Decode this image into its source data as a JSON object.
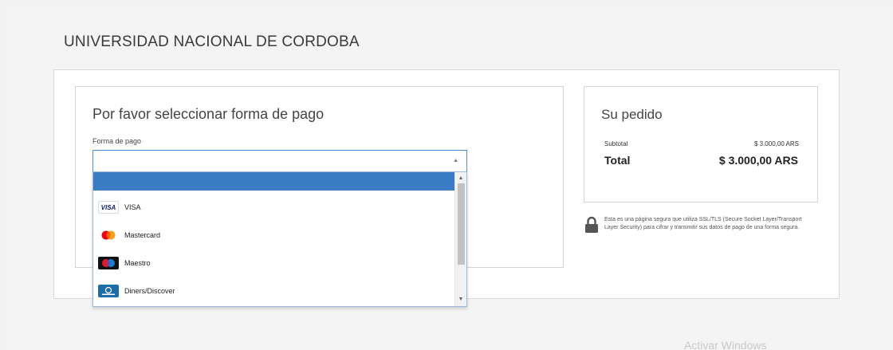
{
  "header": {
    "title": "UNIVERSIDAD NACIONAL DE CORDOBA"
  },
  "payment": {
    "heading": "Por favor seleccionar forma de pago",
    "field_label": "Forma de pago",
    "selected_value": "",
    "options": [
      {
        "label": "VISA",
        "icon": "visa-icon",
        "icon_text": "VISA"
      },
      {
        "label": "Mastercard",
        "icon": "mastercard-icon"
      },
      {
        "label": "Maestro",
        "icon": "maestro-icon"
      },
      {
        "label": "Diners/Discover",
        "icon": "diners-icon"
      }
    ]
  },
  "order": {
    "heading": "Su pedido",
    "subtotal_label": "Subtotal",
    "subtotal_value": "$ 3.000,00 ARS",
    "total_label": "Total",
    "total_value": "$ 3.000,00 ARS"
  },
  "security": {
    "text": "Esta es una página segura que utiliza SSL/TLS (Secure Socket Layer/Transport Layer Security) para cifrar y transmitir sus datos de pago de una forma segura."
  },
  "watermark": "Activar Windows",
  "colors": {
    "accent": "#3a7dc4",
    "border": "#d3d3d3",
    "background": "#f1f1f1"
  }
}
